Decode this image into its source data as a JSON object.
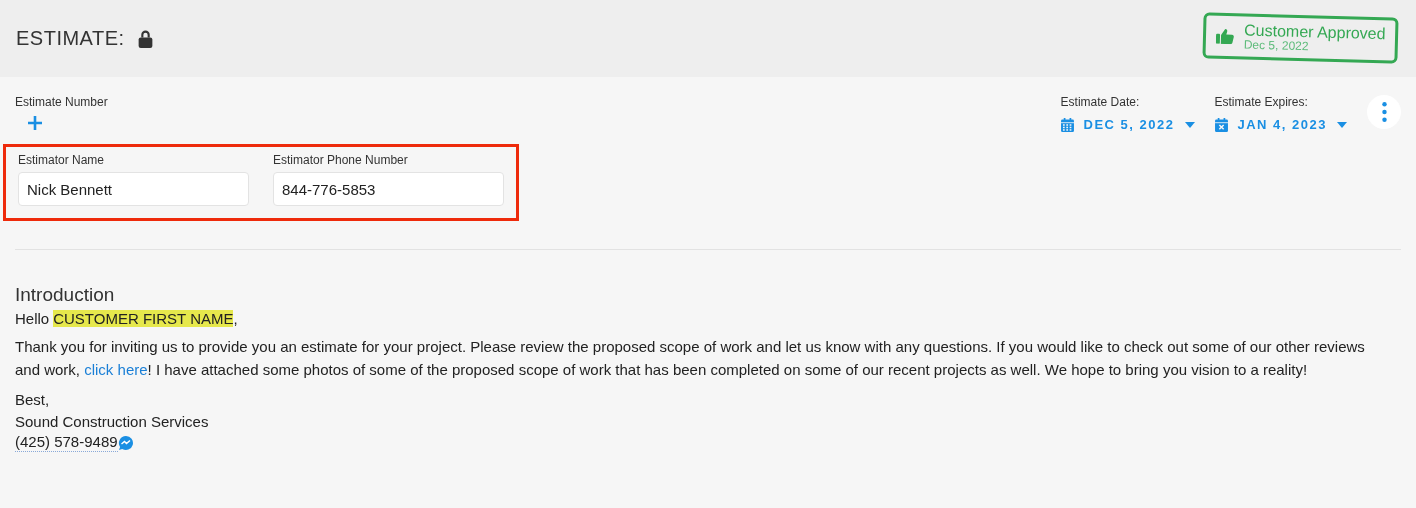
{
  "header": {
    "title": "ESTIMATE:",
    "locked": true,
    "stamp": {
      "title": "Customer Approved",
      "date": "Dec 5, 2022"
    }
  },
  "estimate_number": {
    "label": "Estimate Number"
  },
  "dates": [
    {
      "label": "Estimate Date:",
      "value": "DEC 5, 2022",
      "kind": "date"
    },
    {
      "label": "Estimate Expires:",
      "value": "JAN 4, 2023",
      "kind": "expiry"
    }
  ],
  "estimator": {
    "outlined": true,
    "fields": [
      {
        "label": "Estimator Name",
        "value": "Nick Bennett"
      },
      {
        "label": "Estimator Phone Number",
        "value": "844-776-5853"
      }
    ]
  },
  "introduction": {
    "heading": "Introduction",
    "greeting": [
      {
        "kind": "text",
        "text": "Hello"
      },
      {
        "kind": "highlight",
        "text": "CUSTOMER FIRST NAME"
      },
      {
        "kind": "text",
        "text": ","
      }
    ],
    "body": [
      {
        "kind": "text",
        "text": "Thank you for inviting us to provide you an estimate for your project. Please review the proposed scope of work and let us know with any questions. If you would like to check out some of our other reviews and work, "
      },
      {
        "kind": "link",
        "text": "click here"
      },
      {
        "kind": "text",
        "text": "! I have attached some photos of some of the proposed scope of work that has been completed on some of our recent projects as well. We hope to bring you vision to a reality!"
      }
    ],
    "signoff": [
      "Best,",
      "Sound Construction Services"
    ],
    "phone": "(425) 578-9489"
  }
}
